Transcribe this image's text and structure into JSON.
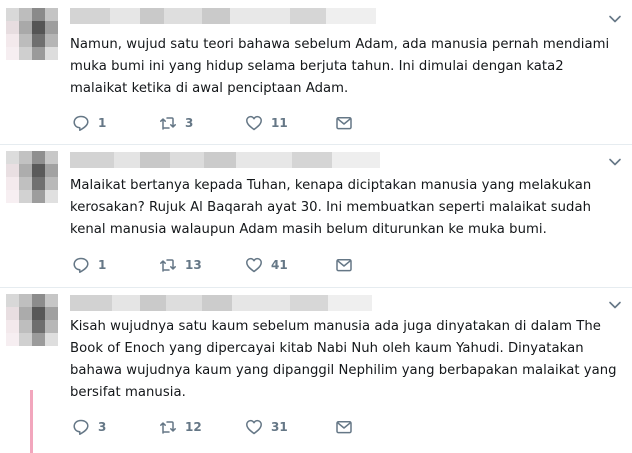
{
  "tweets": [
    {
      "text": "Namun, wujud satu teori bahawa sebelum Adam, ada manusia pernah mendiami muka bumi ini yang hidup selama berjuta tahun. Ini dimulai dengan kata2 malaikat ketika di awal penciptaan Adam.",
      "replies": "1",
      "retweets": "3",
      "likes": "11"
    },
    {
      "text": "Malaikat bertanya kepada Tuhan, kenapa diciptakan manusia yang melakukan kerosakan? Rujuk Al Baqarah ayat 30. Ini membuatkan seperti malaikat sudah kenal manusia walaupun Adam masih belum diturunkan ke muka bumi.",
      "replies": "1",
      "retweets": "13",
      "likes": "41"
    },
    {
      "text": "Kisah wujudnya satu kaum sebelum manusia ada juga dinyatakan di dalam The Book of Enoch yang dipercayai kitab Nabi Nuh oleh kaum Yahudi.  Dinyatakan bahawa wujudnya kaum yang dipanggil Nephilim yang berbapakan malaikat yang bersifat manusia.",
      "replies": "3",
      "retweets": "12",
      "likes": "31"
    }
  ],
  "icons": [
    "reply-icon",
    "retweet-icon",
    "like-icon",
    "direct-message-icon",
    "chevron-down-icon"
  ],
  "colors": {
    "icon": "#657786",
    "divider": "#e6ecf0",
    "thread_line": "#f2a6bd"
  }
}
